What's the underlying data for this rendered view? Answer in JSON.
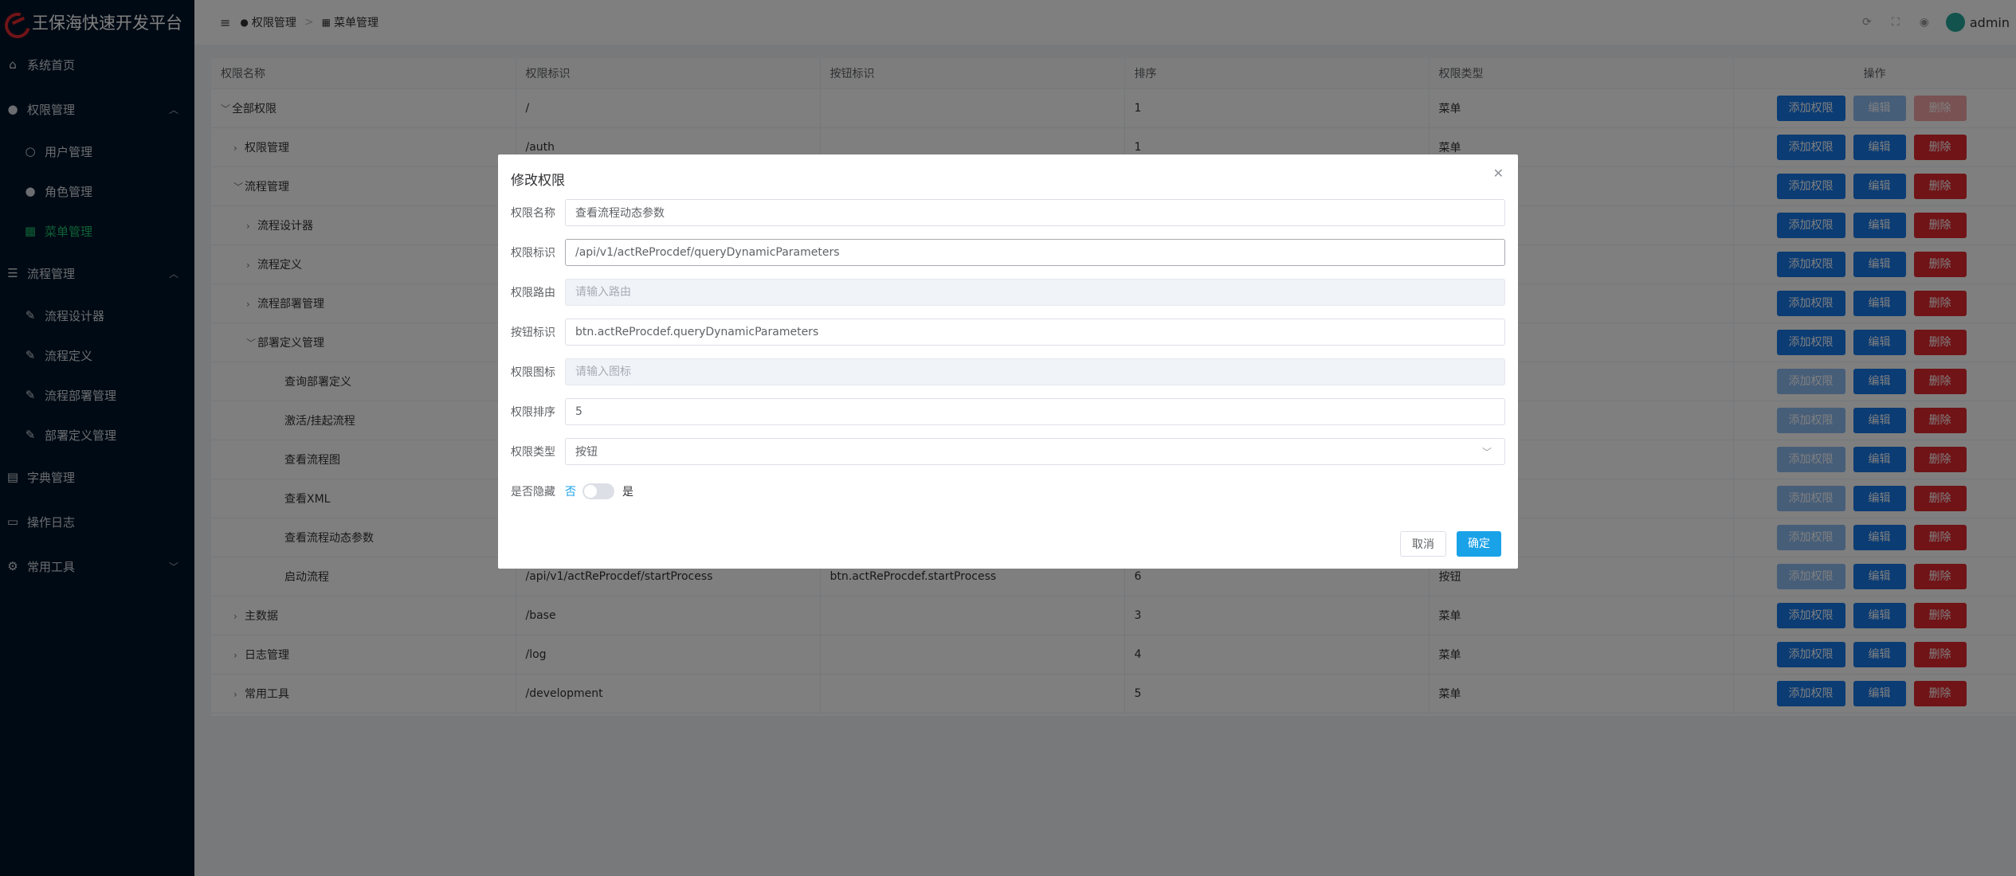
{
  "app": {
    "title": "王保海快速开发平台"
  },
  "sidebar": {
    "items": [
      {
        "label": "系统首页",
        "icon": "home-icon"
      },
      {
        "label": "权限管理",
        "icon": "user-icon"
      },
      {
        "label": "用户管理",
        "icon": "user-outline-icon"
      },
      {
        "label": "角色管理",
        "icon": "user-icon"
      },
      {
        "label": "菜单管理",
        "icon": "grid-icon"
      },
      {
        "label": "流程管理",
        "icon": "sliders-icon"
      },
      {
        "label": "流程设计器",
        "icon": "edit-icon"
      },
      {
        "label": "流程定义",
        "icon": "edit-icon"
      },
      {
        "label": "流程部署管理",
        "icon": "edit-icon"
      },
      {
        "label": "部署定义管理",
        "icon": "edit-icon"
      },
      {
        "label": "字典管理",
        "icon": "clipboard-icon"
      },
      {
        "label": "操作日志",
        "icon": "message-icon"
      },
      {
        "label": "常用工具",
        "icon": "gear-icon"
      }
    ]
  },
  "header": {
    "breadcrumb": [
      "权限管理",
      "菜单管理"
    ],
    "username": "admin"
  },
  "table": {
    "columns": [
      "权限名称",
      "权限标识",
      "按钮标识",
      "排序",
      "权限类型",
      "操作"
    ],
    "ops": {
      "add": "添加权限",
      "edit": "编辑",
      "delete": "删除"
    },
    "rows": [
      {
        "name": "全部权限",
        "code": "/",
        "btn": "",
        "sort": "1",
        "type": "菜单"
      },
      {
        "name": "权限管理",
        "code": "/auth",
        "btn": "",
        "sort": "1",
        "type": "菜单"
      },
      {
        "name": "流程管理",
        "code": "",
        "btn": "",
        "sort": "",
        "type": ""
      },
      {
        "name": "流程设计器",
        "code": "",
        "btn": "",
        "sort": "",
        "type": ""
      },
      {
        "name": "流程定义",
        "code": "",
        "btn": "",
        "sort": "",
        "type": ""
      },
      {
        "name": "流程部署管理",
        "code": "",
        "btn": "",
        "sort": "",
        "type": ""
      },
      {
        "name": "部署定义管理",
        "code": "",
        "btn": "",
        "sort": "",
        "type": ""
      },
      {
        "name": "查询部署定义",
        "code": "",
        "btn": "",
        "sort": "",
        "type": ""
      },
      {
        "name": "激活/挂起流程",
        "code": "",
        "btn": "",
        "sort": "",
        "type": ""
      },
      {
        "name": "查看流程图",
        "code": "",
        "btn": "",
        "sort": "",
        "type": ""
      },
      {
        "name": "查看XML",
        "code": "",
        "btn": "",
        "sort": "",
        "type": ""
      },
      {
        "name": "查看流程动态参数",
        "code": "",
        "btn": "",
        "sort": "",
        "type": ""
      },
      {
        "name": "启动流程",
        "code": "/api/v1/actReProcdef/startProcess",
        "btn": "btn.actReProcdef.startProcess",
        "sort": "6",
        "type": "按钮"
      },
      {
        "name": "主数据",
        "code": "/base",
        "btn": "",
        "sort": "3",
        "type": "菜单"
      },
      {
        "name": "日志管理",
        "code": "/log",
        "btn": "",
        "sort": "4",
        "type": "菜单"
      },
      {
        "name": "常用工具",
        "code": "/development",
        "btn": "",
        "sort": "5",
        "type": "菜单"
      }
    ]
  },
  "dialog": {
    "title": "修改权限",
    "fields": {
      "name": {
        "label": "权限名称",
        "value": "查看流程动态参数"
      },
      "code": {
        "label": "权限标识",
        "value": "/api/v1/actReProcdef/queryDynamicParameters"
      },
      "route": {
        "label": "权限路由",
        "placeholder": "请输入路由"
      },
      "btn": {
        "label": "按钮标识",
        "value": "btn.actReProcdef.queryDynamicParameters"
      },
      "icon": {
        "label": "权限图标",
        "placeholder": "请输入图标"
      },
      "sort": {
        "label": "权限排序",
        "value": "5"
      },
      "type": {
        "label": "权限类型",
        "value": "按钮"
      },
      "hidden": {
        "label": "是否隐藏",
        "off": "否",
        "on": "是",
        "checked": false
      }
    },
    "cancel": "取消",
    "ok": "确定"
  },
  "colors": {
    "sidebar_bg": "#001529",
    "active_menu": "#1ec16c",
    "primary": "#1778e8",
    "danger": "#e0282f",
    "dialog_primary": "#1aa2e8"
  }
}
